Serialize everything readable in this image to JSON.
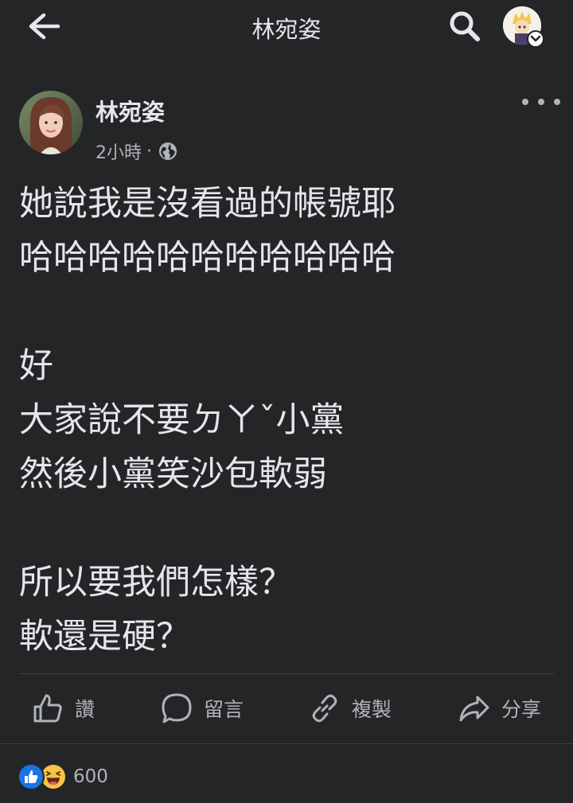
{
  "header": {
    "title": "林宛姿",
    "back_icon": "arrow-left-icon",
    "search_icon": "search-icon",
    "account_icon": "profile-avatar"
  },
  "post": {
    "author": "林宛姿",
    "time": "2小時",
    "separator": "·",
    "privacy_icon": "globe-icon",
    "lines": [
      "她說我是沒看過的帳號耶",
      "哈哈哈哈哈哈哈哈哈哈哈",
      "",
      "好",
      "大家說不要ㄉㄚˇ小黨",
      "然後小黨笑沙包軟弱",
      "",
      "所以要我們怎樣？",
      "軟還是硬？"
    ]
  },
  "actions": {
    "like_label": "讚",
    "comment_label": "留言",
    "copy_label": "複製",
    "share_label": "分享"
  },
  "reactions": {
    "count": "600",
    "icons": [
      "like-reaction-icon",
      "haha-reaction-icon"
    ]
  },
  "colors": {
    "background": "#242526",
    "text": "#e4e6eb",
    "secondary": "#b0b3b8",
    "like_blue": "#1b74e4",
    "haha_yellow": "#f7c444"
  }
}
